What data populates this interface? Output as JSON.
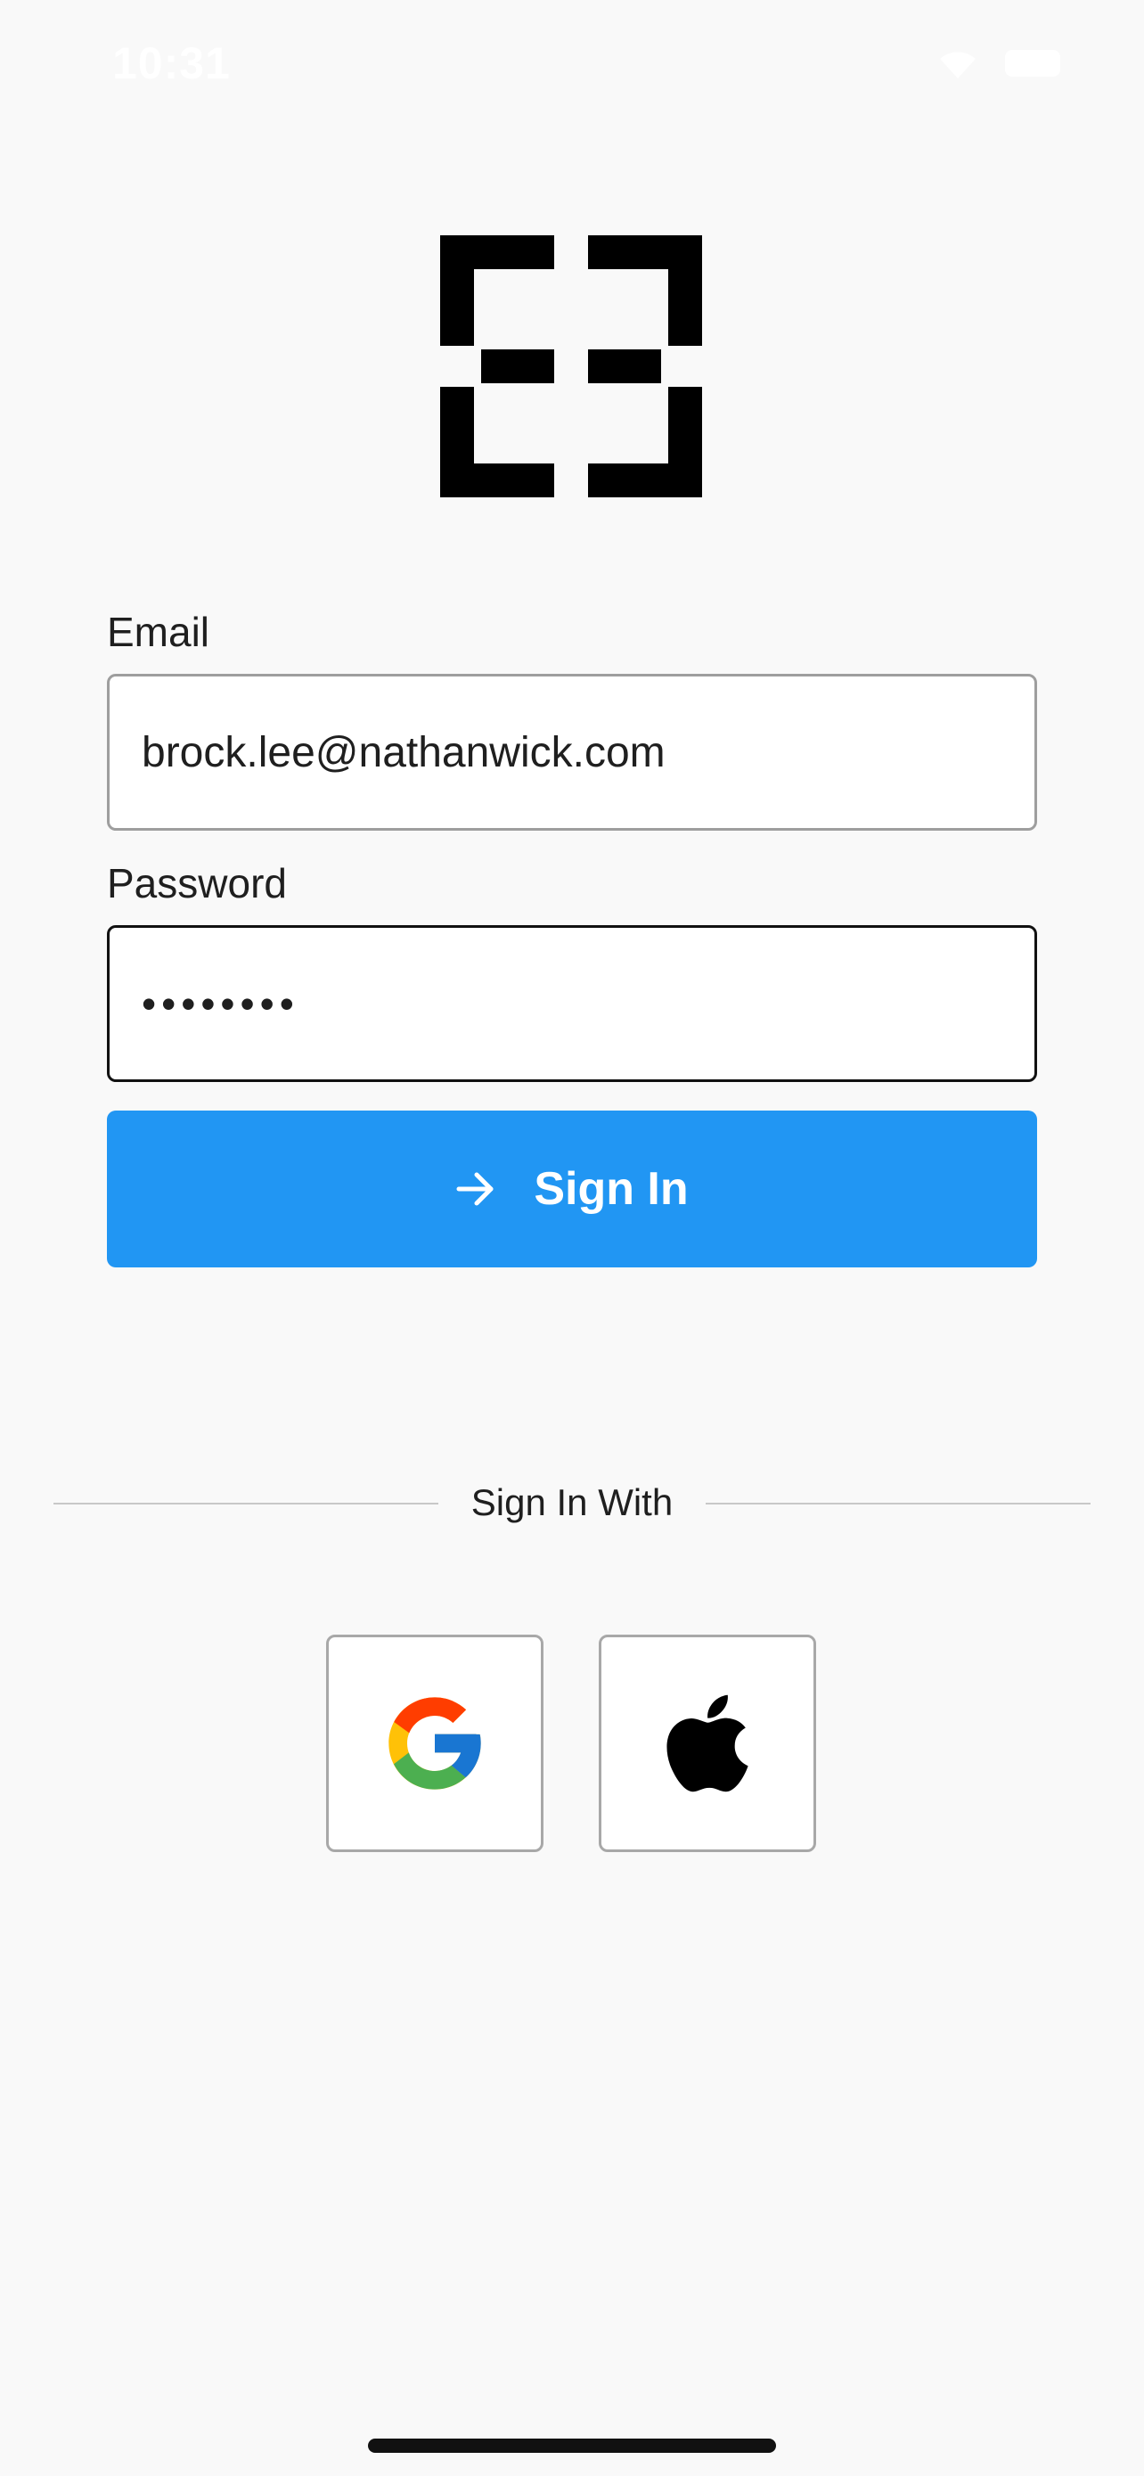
{
  "status_bar": {
    "time": "10:31"
  },
  "logo": {
    "icon": "bracket-logo-icon"
  },
  "form": {
    "email_label": "Email",
    "email_value": "brock.lee@nathanwick.com",
    "password_label": "Password",
    "password_value": "••••••••",
    "sign_in_label": "Sign In",
    "sign_in_icon": "arrow-right-icon"
  },
  "social": {
    "divider_text": "Sign In With",
    "google_icon": "google-icon",
    "apple_icon": "apple-icon"
  },
  "colors": {
    "background": "#f9f9f9",
    "primary": "#2196f3",
    "text": "#1f1f1f"
  }
}
